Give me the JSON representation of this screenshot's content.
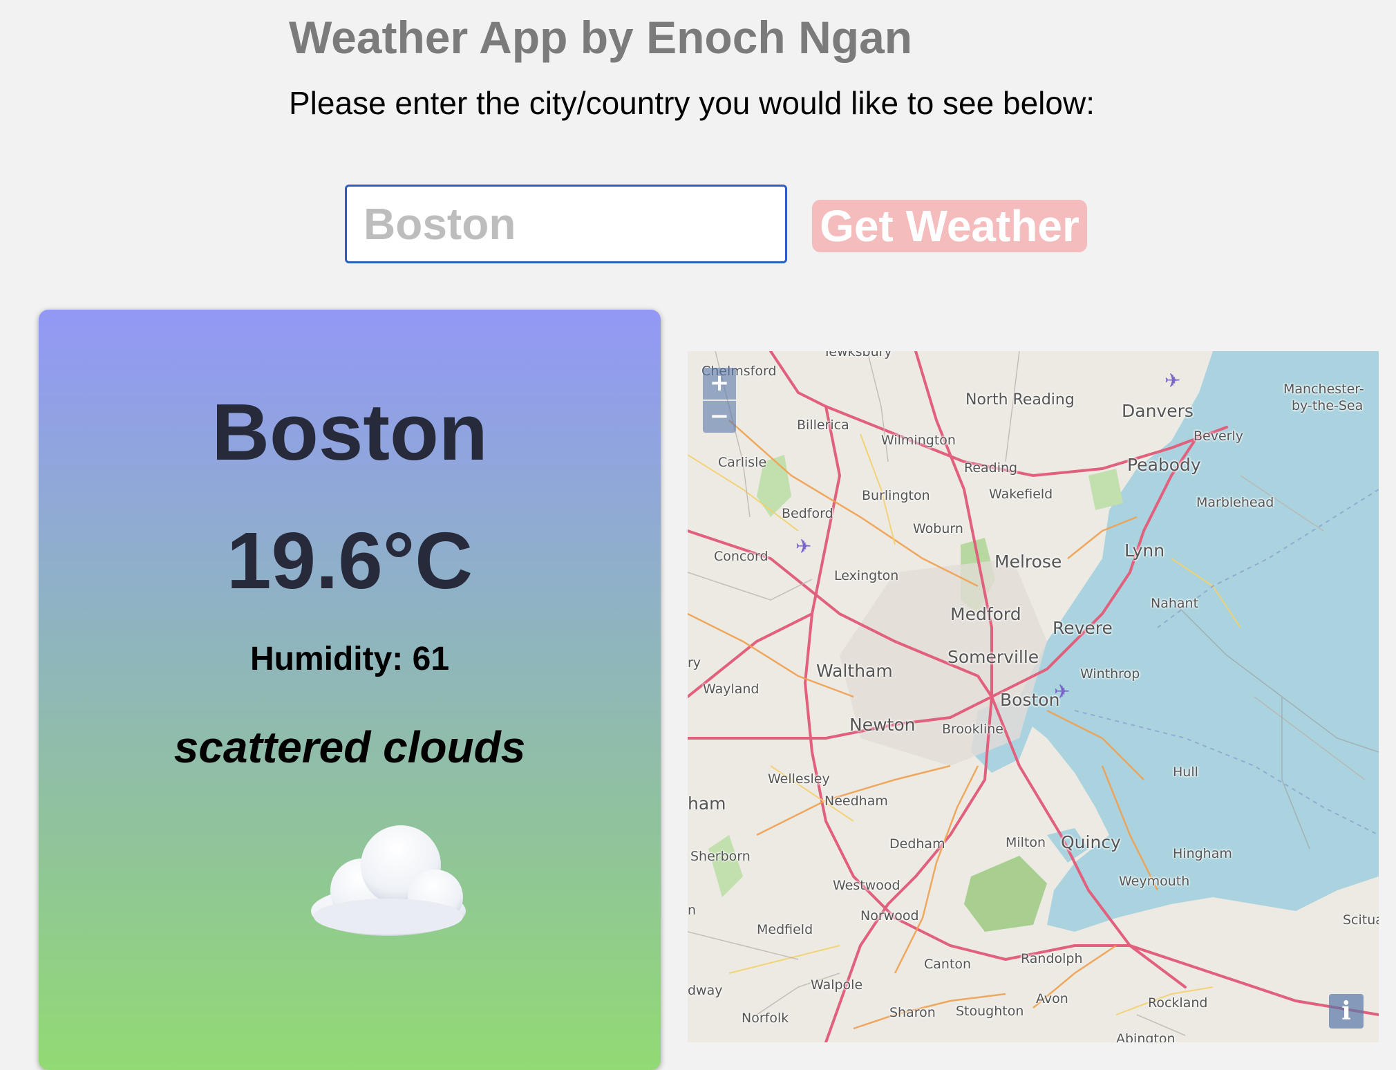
{
  "header": {
    "title": "Weather App by Enoch Ngan",
    "subtitle": "Please enter the city/country you would like to see below:"
  },
  "search": {
    "value": "Boston",
    "button_label": "Get Weather"
  },
  "weather": {
    "city": "Boston",
    "temperature": "19.6°C",
    "humidity_label": "Humidity: 61",
    "description": "scattered clouds",
    "icon": "cloud-icon"
  },
  "map": {
    "zoom_in_label": "+",
    "zoom_out_label": "−",
    "info_label": "i",
    "labels": {
      "tewksbury": "Tewksbury",
      "chelmsford": "Chelmsford",
      "north_reading": "North Reading",
      "danvers": "Danvers",
      "manchester": "Manchester-",
      "by_the_sea": "by-the-Sea",
      "billerica": "Billerica",
      "wilmington": "Wilmington",
      "beverly": "Beverly",
      "carlisle": "Carlisle",
      "reading": "Reading",
      "peabody": "Peabody",
      "burlington": "Burlington",
      "wakefield": "Wakefield",
      "marblehead": "Marblehead",
      "bedford": "Bedford",
      "woburn": "Woburn",
      "concord": "Concord",
      "melrose": "Melrose",
      "lynn": "Lynn",
      "lexington": "Lexington",
      "nahant": "Nahant",
      "medford": "Medford",
      "revere": "Revere",
      "somerville": "Somerville",
      "waltham": "Waltham",
      "winthrop": "Winthrop",
      "wayland": "Wayland",
      "boston": "Boston",
      "newton": "Newton",
      "brookline": "Brookline",
      "hull": "Hull",
      "wellesley": "Wellesley",
      "needham": "Needham",
      "ham": "ham",
      "dedham": "Dedham",
      "milton": "Milton",
      "quincy": "Quincy",
      "sherborn": "Sherborn",
      "hingham": "Hingham",
      "westwood": "Westwood",
      "weymouth": "Weymouth",
      "norwood": "Norwood",
      "scituate": "Scitua",
      "medfield": "Medfield",
      "canton": "Canton",
      "randolph": "Randolph",
      "walpole": "Walpole",
      "dway": "dway",
      "avon": "Avon",
      "rockland": "Rockland",
      "sharon": "Sharon",
      "stoughton": "Stoughton",
      "norfolk": "Norfolk",
      "abington": "Abington",
      "ry": "ry",
      "n": "n"
    }
  },
  "colors": {
    "title_gray": "#7b7b7b",
    "button_bg": "#f4bcbc",
    "input_border": "#2b5fc2",
    "card_gradient_top": "#9298f5",
    "card_gradient_bottom": "#92da74",
    "sea": "#aad3df",
    "major_road": "#e0607e"
  }
}
